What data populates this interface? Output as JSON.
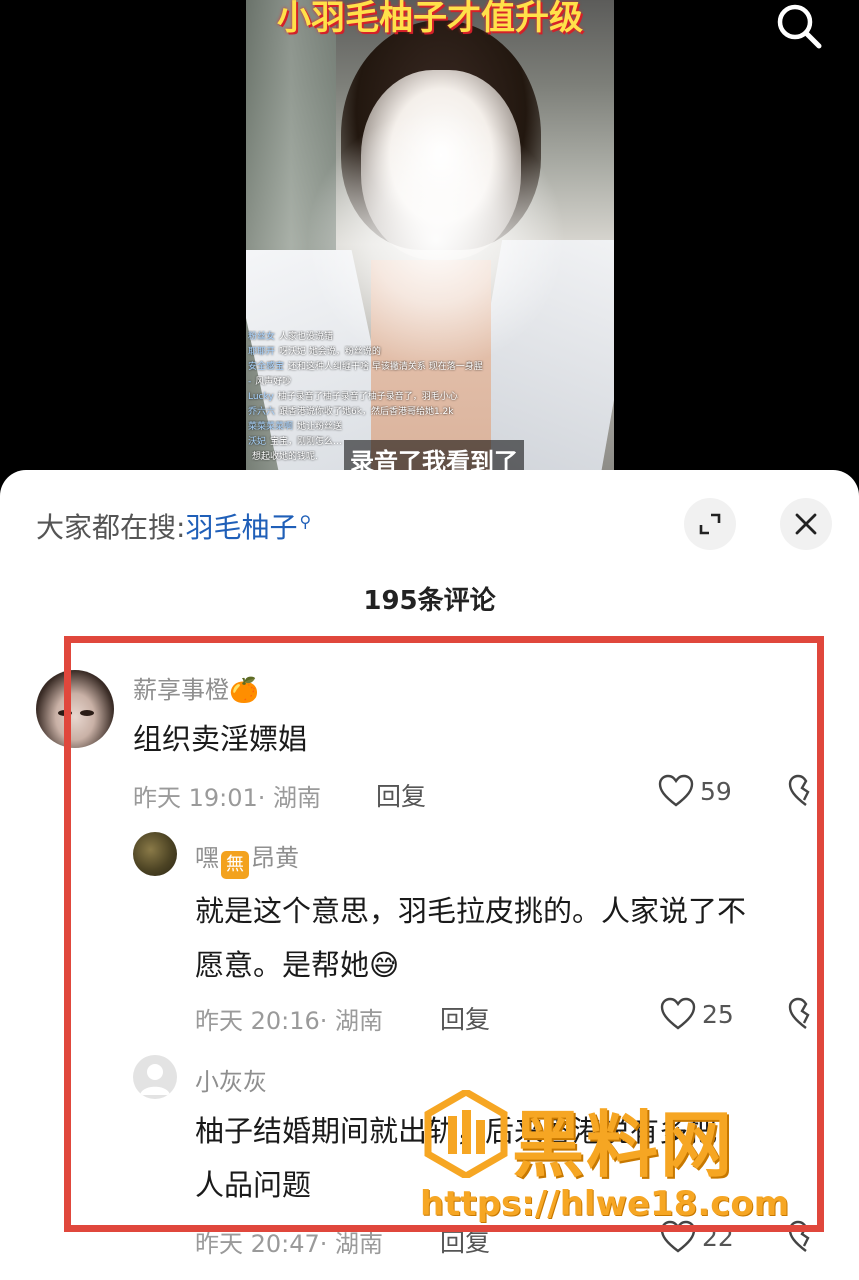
{
  "video": {
    "title_overlay": "小羽毛柚子才值升级",
    "subtitle": "录音了我看到了",
    "chat": [
      {
        "user": "粉丝女",
        "text": "人家也没说错"
      },
      {
        "user": "耶耶开",
        "text": "呀沃妃 她会说，粉丝说的"
      },
      {
        "user": "安全感宝",
        "text": "还和这种人纠缠干啥 早该撇清关系 现在落一身腥"
      },
      {
        "user": "-",
        "text": "风声好吵"
      },
      {
        "user": "Lucky",
        "text": "柚子录音了柚子录音了柚子录音了，羽毛小心"
      },
      {
        "user": "乔六六",
        "text": "跟香港说你收了她6k，然后香港哥给她1.2k"
      },
      {
        "user": "菜菜菜菜啊",
        "text": "她让粉丝送"
      },
      {
        "user": "沃妃",
        "text": "宝宝，刚刚怎么…"
      },
      {
        "user": "",
        "text": "想起收她的钱呢."
      }
    ]
  },
  "icons": {
    "search": "search-icon",
    "expand": "expand-icon",
    "close": "close-icon",
    "heart": "heart-icon",
    "broken_heart": "broken-heart-icon",
    "search_mini": "search-mini-icon"
  },
  "sheet": {
    "search_prefix": "大家都在搜:",
    "search_keyword": "羽毛柚子",
    "comment_count_title": "195条评论"
  },
  "comments": [
    {
      "nickname": "薪享事橙",
      "nickname_emoji": "🍊",
      "text": "组织卖淫嫖娼",
      "meta": "昨天 19:01· 湖南",
      "reply_label": "回复",
      "likes": "59"
    },
    {
      "nickname_prefix": "嘿",
      "nickname_badge": "無",
      "nickname_suffix": "昂黄",
      "text_line1": "就是这个意思，羽毛拉皮挑的。人家说了不",
      "text_line2": "愿意。是帮她",
      "text_emoji": "😅",
      "meta": "昨天 20:16· 湖南",
      "reply_label": "回复",
      "likes": "25"
    },
    {
      "nickname": "小灰灰",
      "text_line1": "柚子结婚期间就出轨，后来香港说有多把",
      "text_line2": "人品问题",
      "meta": "昨天 20:47· 湖南",
      "reply_label": "回复",
      "likes": "22"
    }
  ],
  "watermark": {
    "title": "黑料网",
    "url": "https://hlwe18.com"
  },
  "colors": {
    "accent_link": "#1f5fb8",
    "highlight_frame": "#e0473c",
    "watermark": "#f6a623"
  }
}
